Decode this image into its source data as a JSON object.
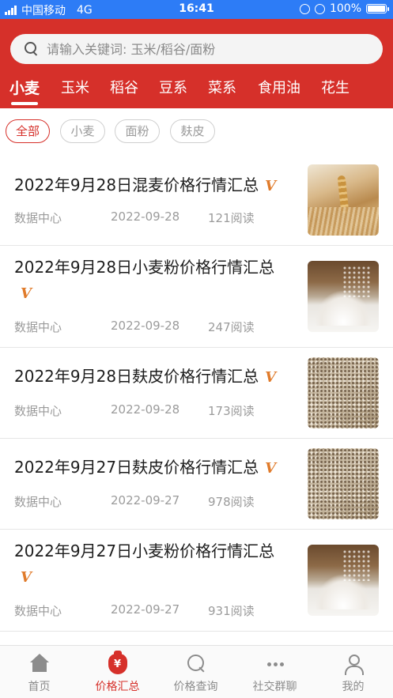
{
  "status_bar": {
    "carrier": "中国移动",
    "network": "4G",
    "time": "16:41",
    "battery_text": "100%",
    "battery_level": 1.0
  },
  "search": {
    "placeholder": "请输入关键词: 玉米/稻谷/面粉"
  },
  "category_tabs": [
    {
      "label": "小麦",
      "active": true
    },
    {
      "label": "玉米",
      "active": false
    },
    {
      "label": "稻谷",
      "active": false
    },
    {
      "label": "豆系",
      "active": false
    },
    {
      "label": "菜系",
      "active": false
    },
    {
      "label": "食用油",
      "active": false
    },
    {
      "label": "花生",
      "active": false
    }
  ],
  "filter_chips": [
    {
      "label": "全部",
      "active": true
    },
    {
      "label": "小麦",
      "active": false
    },
    {
      "label": "面粉",
      "active": false
    },
    {
      "label": "麸皮",
      "active": false
    }
  ],
  "articles": [
    {
      "title": "2022年9月28日混麦价格行情汇总",
      "source": "数据中心",
      "date": "2022-09-28",
      "reads": "121阅读",
      "badge": "V",
      "image": "wheat-field-photo"
    },
    {
      "title": "2022年9月28日小麦粉价格行情汇总",
      "source": "数据中心",
      "date": "2022-09-28",
      "reads": "247阅读",
      "badge": "V",
      "image": "flour-pile-photo"
    },
    {
      "title": "2022年9月28日麸皮价格行情汇总",
      "source": "数据中心",
      "date": "2022-09-28",
      "reads": "173阅读",
      "badge": "V",
      "image": "bran-photo"
    },
    {
      "title": "2022年9月27日麸皮价格行情汇总",
      "source": "数据中心",
      "date": "2022-09-27",
      "reads": "978阅读",
      "badge": "V",
      "image": "bran-photo"
    },
    {
      "title": "2022年9月27日小麦粉价格行情汇总",
      "source": "数据中心",
      "date": "2022-09-27",
      "reads": "931阅读",
      "badge": "V",
      "image": "flour-pile-photo"
    }
  ],
  "bottom_nav": [
    {
      "label": "首页",
      "icon": "home-icon",
      "active": false
    },
    {
      "label": "价格汇总",
      "icon": "money-bag-icon",
      "active": true
    },
    {
      "label": "价格查询",
      "icon": "search-icon",
      "active": false
    },
    {
      "label": "社交群聊",
      "icon": "chat-dots-icon",
      "active": false
    },
    {
      "label": "我的",
      "icon": "user-icon",
      "active": false
    }
  ],
  "colors": {
    "brand_red": "#d6302a",
    "status_bar_blue": "#2d7cf6",
    "badge_orange": "#e07b2b"
  }
}
